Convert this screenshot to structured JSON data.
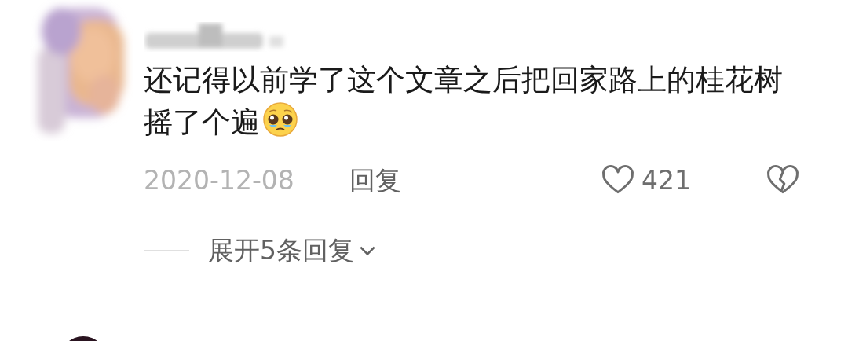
{
  "comment": {
    "text": "还记得以前学了这个文章之后把回家路上的桂花树摇了个遍",
    "date": "2020-12-08",
    "reply_label": "回复",
    "likes": "421"
  },
  "expand_replies": {
    "label": "展开5条回复"
  }
}
